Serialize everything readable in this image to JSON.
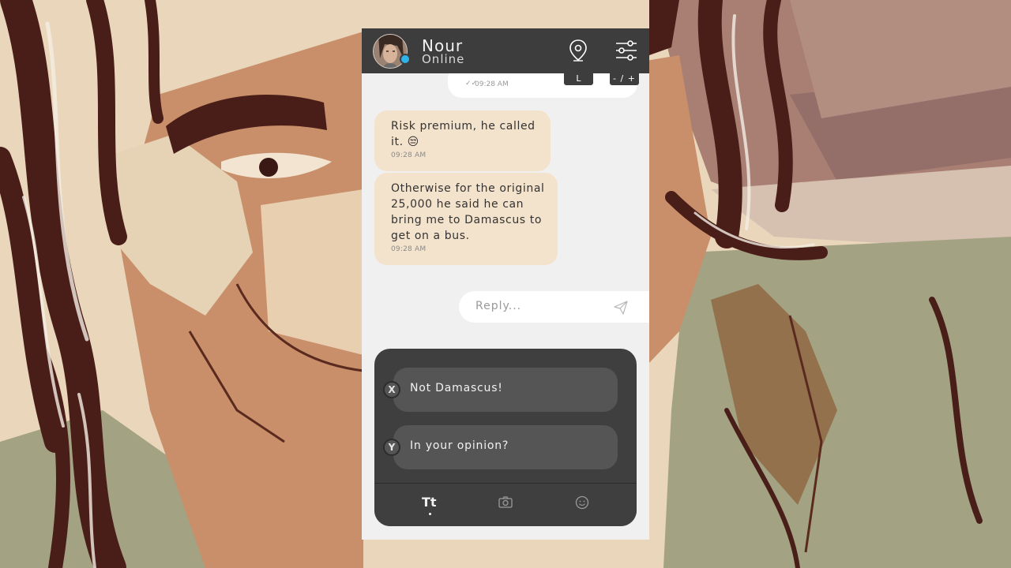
{
  "contact": {
    "name": "Nour",
    "status": "Online"
  },
  "header": {
    "location_icon": "map-pin-icon",
    "settings_icon": "sliders-icon",
    "location_key": "L",
    "zoom_key": "- / +"
  },
  "messages": [
    {
      "direction": "outgoing",
      "text": "",
      "time": "09:28 AM",
      "read": true
    },
    {
      "direction": "incoming",
      "text": "Risk premium, he called it. 😒",
      "time": "09:28 AM"
    },
    {
      "direction": "incoming",
      "text": "Otherwise for the original 25,000 he said he can bring me to Damascus to get on a bus.",
      "time": "09:28 AM"
    }
  ],
  "reply": {
    "placeholder": "Reply...",
    "send_icon": "paper-plane-icon"
  },
  "choices": [
    {
      "button": "X",
      "label": "Not Damascus!"
    },
    {
      "button": "Y",
      "label": "In your opinion?"
    }
  ],
  "toolbar": {
    "text_tool": "Tt",
    "camera_icon": "camera-icon",
    "emoji_icon": "smiley-icon"
  },
  "colors": {
    "header": "#3d3d3d",
    "incoming_bubble": "#f4e3cc",
    "online_dot": "#2fb3e8",
    "choice_panel": "#3f3f3f",
    "choice_button": "#555555"
  }
}
